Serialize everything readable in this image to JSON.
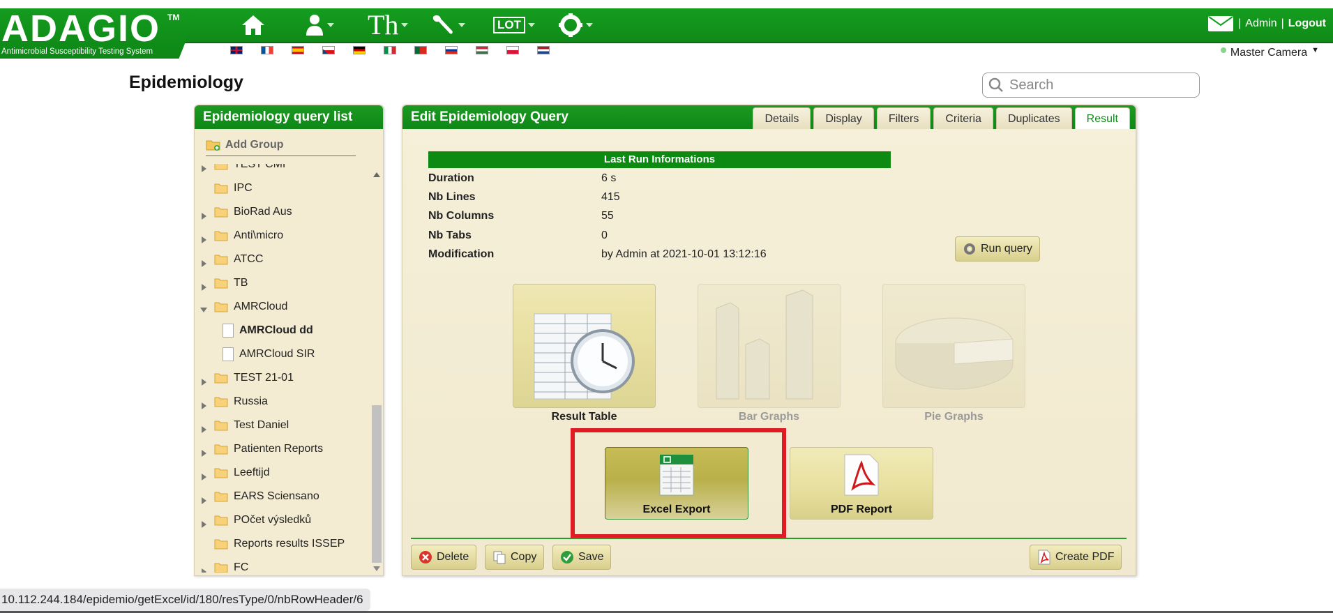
{
  "header": {
    "logo": "ADAGIO",
    "logo_tm": "TM",
    "subtitle": "Antimicrobial Susceptibility Testing System",
    "nav_icons": [
      "home-icon",
      "user-icon",
      "text-icon",
      "wrench-icon",
      "lot-icon",
      "gear-icon"
    ],
    "lot_label": "LOT",
    "th_label": "Th",
    "flags": [
      "uk",
      "fr",
      "es",
      "cz",
      "de",
      "it",
      "pt",
      "ru",
      "hu",
      "pl",
      "nl"
    ],
    "admin": "Admin",
    "logout": "Logout",
    "camera": "Master Camera"
  },
  "page": {
    "title": "Epidemiology",
    "search_placeholder": "Search"
  },
  "left_panel": {
    "title": "Epidemiology query list",
    "add_group": "Add Group",
    "items": [
      {
        "label": "TEST CMI",
        "type": "folder",
        "expanded": false
      },
      {
        "label": "IPC",
        "type": "folder",
        "expanded": null
      },
      {
        "label": "BioRad Aus",
        "type": "folder",
        "expanded": false
      },
      {
        "label": "Anti\\micro",
        "type": "folder",
        "expanded": false
      },
      {
        "label": "ATCC",
        "type": "folder",
        "expanded": false
      },
      {
        "label": "TB",
        "type": "folder",
        "expanded": false
      },
      {
        "label": "AMRCloud",
        "type": "folder",
        "expanded": true
      },
      {
        "label": "AMRCloud dd",
        "type": "doc",
        "bold": true
      },
      {
        "label": "AMRCloud SIR",
        "type": "doc",
        "bold": false
      },
      {
        "label": "TEST 21-01",
        "type": "folder",
        "expanded": false
      },
      {
        "label": "Russia",
        "type": "folder",
        "expanded": false
      },
      {
        "label": "Test Daniel",
        "type": "folder",
        "expanded": false
      },
      {
        "label": "Patienten Reports",
        "type": "folder",
        "expanded": false
      },
      {
        "label": "Leeftijd",
        "type": "folder",
        "expanded": false
      },
      {
        "label": "EARS Sciensano",
        "type": "folder",
        "expanded": false
      },
      {
        "label": "POčet výsledků",
        "type": "folder",
        "expanded": false
      },
      {
        "label": "Reports results ISSEP",
        "type": "folder",
        "expanded": null
      },
      {
        "label": "FC",
        "type": "folder",
        "expanded": false
      }
    ]
  },
  "right_panel": {
    "title": "Edit Epidemiology Query",
    "tabs": [
      "Details",
      "Display",
      "Filters",
      "Criteria",
      "Duplicates",
      "Result"
    ],
    "active_tab": "Result",
    "info_title": "Last Run Informations",
    "info": [
      {
        "key": "Duration",
        "value": "6 s"
      },
      {
        "key": "Nb Lines",
        "value": "415"
      },
      {
        "key": "Nb Columns",
        "value": "55"
      },
      {
        "key": "Nb Tabs",
        "value": "0"
      },
      {
        "key": "Modification",
        "value": "by Admin at 2021-10-01 13:12:16"
      }
    ],
    "run_query": "Run query",
    "tiles": [
      {
        "label": "Result Table",
        "enabled": true
      },
      {
        "label": "Bar Graphs",
        "enabled": false
      },
      {
        "label": "Pie Graphs",
        "enabled": false
      }
    ],
    "exports": [
      {
        "label": "Excel Export",
        "highlighted": true
      },
      {
        "label": "PDF Report",
        "highlighted": false
      }
    ],
    "actions": {
      "delete": "Delete",
      "copy": "Copy",
      "save": "Save",
      "create_pdf": "Create PDF"
    }
  },
  "status_url": "10.112.244.184/epidemio/getExcel/id/180/resType/0/nbRowHeader/6",
  "colors": {
    "brand_green": "#118f19",
    "highlight_red": "#e01b24",
    "panel_bg": "#f3ecd3"
  }
}
